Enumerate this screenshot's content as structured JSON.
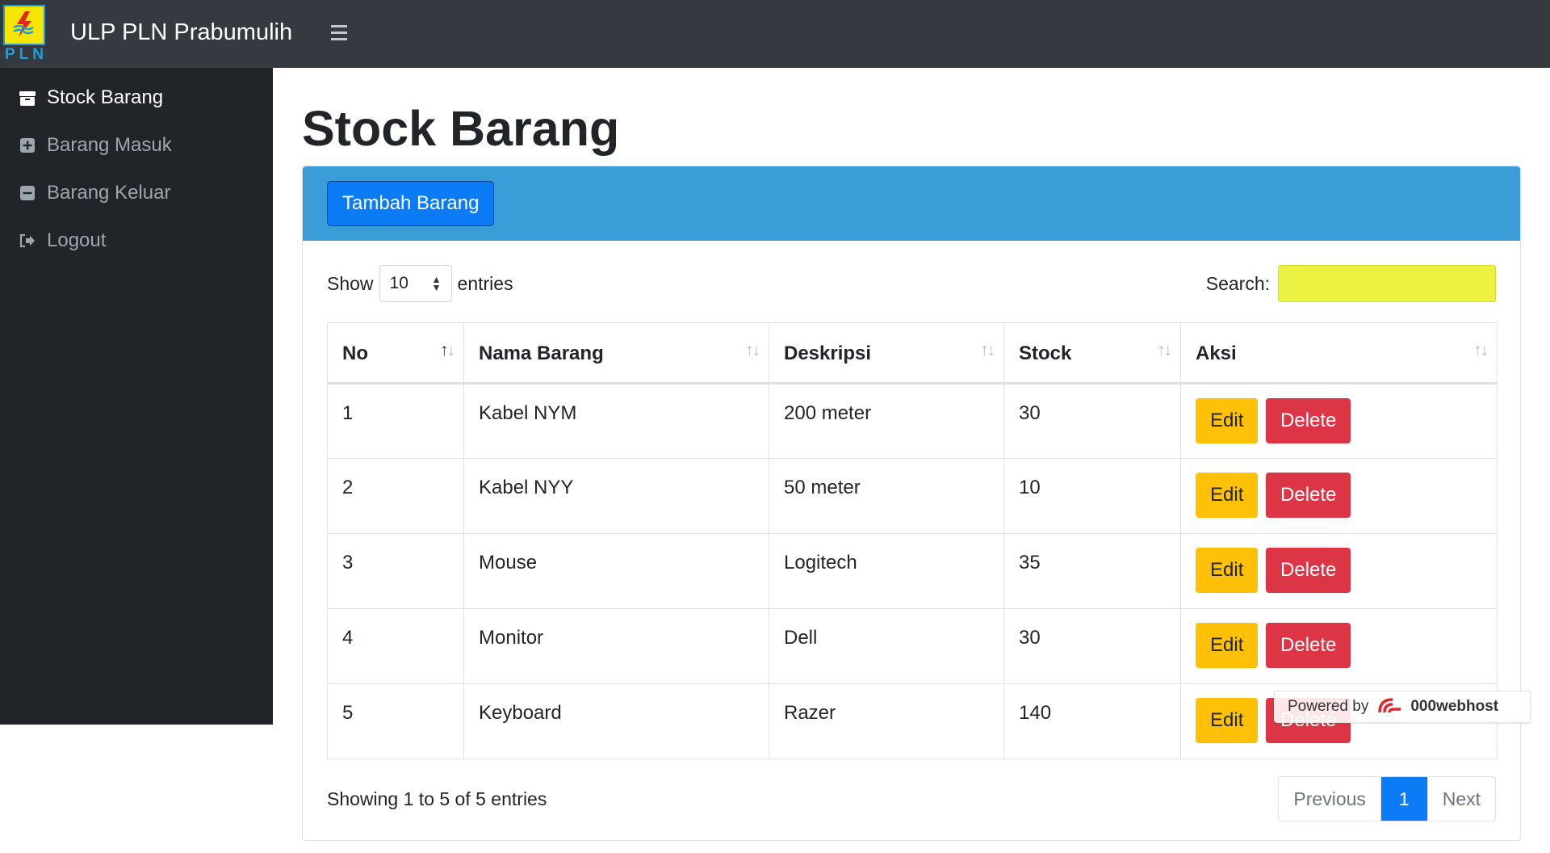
{
  "app": {
    "logo_text": "PLN",
    "brand_name": "ULP PLN Prabumulih"
  },
  "sidebar": {
    "items": [
      {
        "label": "Stock Barang",
        "icon": "box-icon",
        "active": true
      },
      {
        "label": "Barang Masuk",
        "icon": "plus-square-icon",
        "active": false
      },
      {
        "label": "Barang Keluar",
        "icon": "minus-square-icon",
        "active": false
      },
      {
        "label": "Logout",
        "icon": "logout-icon",
        "active": false
      }
    ]
  },
  "page": {
    "title": "Stock Barang",
    "add_button": "Tambah Barang"
  },
  "table_controls": {
    "show_label": "Show",
    "entries_value": "10",
    "entries_label": "entries",
    "search_label": "Search:",
    "search_value": ""
  },
  "table": {
    "columns": [
      "No",
      "Nama Barang",
      "Deskripsi",
      "Stock",
      "Aksi"
    ],
    "rows": [
      {
        "no": "1",
        "nama": "Kabel NYM",
        "deskripsi": "200 meter",
        "stock": "30"
      },
      {
        "no": "2",
        "nama": "Kabel NYY",
        "deskripsi": "50 meter",
        "stock": "10"
      },
      {
        "no": "3",
        "nama": "Mouse",
        "deskripsi": "Logitech",
        "stock": "35"
      },
      {
        "no": "4",
        "nama": "Monitor",
        "deskripsi": "Dell",
        "stock": "30"
      },
      {
        "no": "5",
        "nama": "Keyboard",
        "deskripsi": "Razer",
        "stock": "140"
      }
    ],
    "edit_label": "Edit",
    "delete_label": "Delete"
  },
  "footer": {
    "info": "Showing 1 to 5 of 5 entries",
    "previous": "Previous",
    "current_page": "1",
    "next": "Next"
  },
  "badge": {
    "powered_by": "Powered by",
    "host": "000webhost"
  },
  "colors": {
    "navbar": "#343a40",
    "sidebar": "#212529",
    "card_header": "#3a9dd8",
    "primary": "#0b7cf6",
    "warning": "#ffc107",
    "danger": "#dc3545",
    "search_highlight": "#ecf241"
  }
}
